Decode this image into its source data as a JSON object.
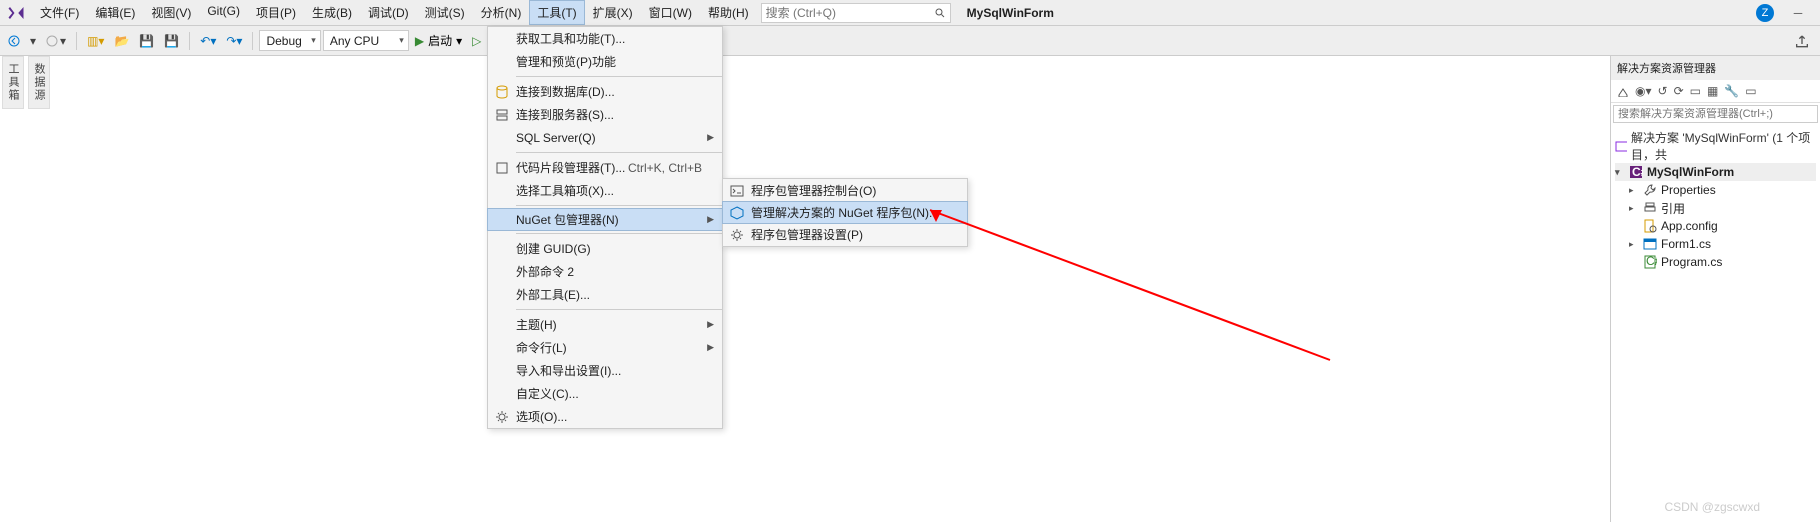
{
  "menu": [
    "文件(F)",
    "编辑(E)",
    "视图(V)",
    "Git(G)",
    "项目(P)",
    "生成(B)",
    "调试(D)",
    "测试(S)",
    "分析(N)",
    "工具(T)",
    "扩展(X)",
    "窗口(W)",
    "帮助(H)"
  ],
  "menu_active": 9,
  "search_placeholder": "搜索 (Ctrl+Q)",
  "project_name": "MySqlWinForm",
  "user_initial": "Z",
  "toolbar": {
    "config": "Debug",
    "platform": "Any CPU",
    "start": "启动"
  },
  "left_tabs": [
    "工具箱",
    "数据源"
  ],
  "tools_menu": [
    {
      "label": "获取工具和功能(T)...",
      "icon": ""
    },
    {
      "label": "管理和预览(P)功能",
      "icon": ""
    },
    {
      "sep": true
    },
    {
      "label": "连接到数据库(D)...",
      "icon": "db"
    },
    {
      "label": "连接到服务器(S)...",
      "icon": "srv"
    },
    {
      "label": "SQL Server(Q)",
      "icon": "",
      "arrow": true
    },
    {
      "sep": true
    },
    {
      "label": "代码片段管理器(T)...",
      "icon": "snip",
      "shortcut": "Ctrl+K, Ctrl+B"
    },
    {
      "label": "选择工具箱项(X)...",
      "icon": ""
    },
    {
      "sep": true
    },
    {
      "label": "NuGet 包管理器(N)",
      "icon": "",
      "arrow": true,
      "hover": true
    },
    {
      "sep": true
    },
    {
      "label": "创建 GUID(G)",
      "icon": ""
    },
    {
      "label": "外部命令 2",
      "icon": ""
    },
    {
      "label": "外部工具(E)...",
      "icon": ""
    },
    {
      "sep": true
    },
    {
      "label": "主题(H)",
      "icon": "",
      "arrow": true
    },
    {
      "label": "命令行(L)",
      "icon": "",
      "arrow": true
    },
    {
      "label": "导入和导出设置(I)...",
      "icon": ""
    },
    {
      "label": "自定义(C)...",
      "icon": ""
    },
    {
      "label": "选项(O)...",
      "icon": "gear"
    }
  ],
  "nuget_submenu": [
    {
      "label": "程序包管理器控制台(O)",
      "icon": "console"
    },
    {
      "label": "管理解决方案的 NuGet 程序包(N)...",
      "icon": "pkg",
      "hover": true
    },
    {
      "label": "程序包管理器设置(P)",
      "icon": "gear"
    }
  ],
  "explorer": {
    "title": "解决方案资源管理器",
    "search_placeholder": "搜索解决方案资源管理器(Ctrl+;)",
    "solution": "解决方案 'MySqlWinForm' (1 个项目，共",
    "items": [
      {
        "label": "MySqlWinForm",
        "bold": true,
        "exp": "▾",
        "icon": "cs"
      },
      {
        "label": "Properties",
        "exp": "▸",
        "ind": 1,
        "icon": "wrench"
      },
      {
        "label": "引用",
        "exp": "▸",
        "ind": 1,
        "icon": "ref"
      },
      {
        "label": "App.config",
        "ind": 1,
        "icon": "cfg"
      },
      {
        "label": "Form1.cs",
        "exp": "▸",
        "ind": 1,
        "icon": "form"
      },
      {
        "label": "Program.cs",
        "ind": 1,
        "icon": "csfile"
      }
    ]
  },
  "watermark": "CSDN @zgscwxd"
}
